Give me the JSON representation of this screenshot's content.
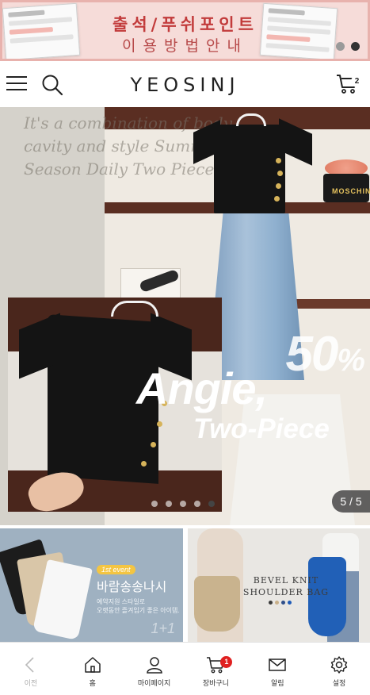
{
  "promo": {
    "title": "출석/푸쉬포인트",
    "subtitle": "이용방법안내",
    "slide_count": 2,
    "active_slide": 2,
    "colors": {
      "background": "#f6dcd9",
      "border": "#e8b2ad",
      "title": "#c23b3b"
    }
  },
  "header": {
    "menu_icon": "hamburger-icon",
    "search_icon": "search-icon",
    "logo": "YEOSINJ",
    "cart_icon": "cart-icon",
    "cart_count": "2"
  },
  "hero": {
    "background_script": "It's a combination of body, cavity and style Summer Season Daily Two Piece Set!",
    "sale_value": "50",
    "sale_unit": "%",
    "headline": "Angie,",
    "subheadline": "Two-Piece",
    "brand_on_bag": "MOSCHINO",
    "slide_current": 5,
    "slide_total": 5,
    "counter_text": "5 / 5"
  },
  "banners": [
    {
      "badge": "1st event",
      "title": "바람송송나시",
      "desc_lines": [
        "예약지원 스타일로",
        "오랫동안 즐겨입기 좋은 아이템."
      ],
      "footer": "1+1"
    },
    {
      "title_line1": "BEVEL KNIT",
      "title_line2": "SHOULDER BAG",
      "swatch_colors": [
        "#3a3a3a",
        "#c9b089",
        "#2f4f8a",
        "#1e5bb8"
      ]
    }
  ],
  "bottom_nav": {
    "items": [
      {
        "label": "이전",
        "icon": "back-arrow-icon",
        "enabled": false
      },
      {
        "label": "홈",
        "icon": "home-icon",
        "enabled": true
      },
      {
        "label": "마이페이지",
        "icon": "user-icon",
        "enabled": true
      },
      {
        "label": "장바구니",
        "icon": "cart-icon",
        "enabled": true,
        "badge": "1"
      },
      {
        "label": "알림",
        "icon": "mail-icon",
        "enabled": true
      },
      {
        "label": "설정",
        "icon": "gear-icon",
        "enabled": true
      }
    ]
  }
}
